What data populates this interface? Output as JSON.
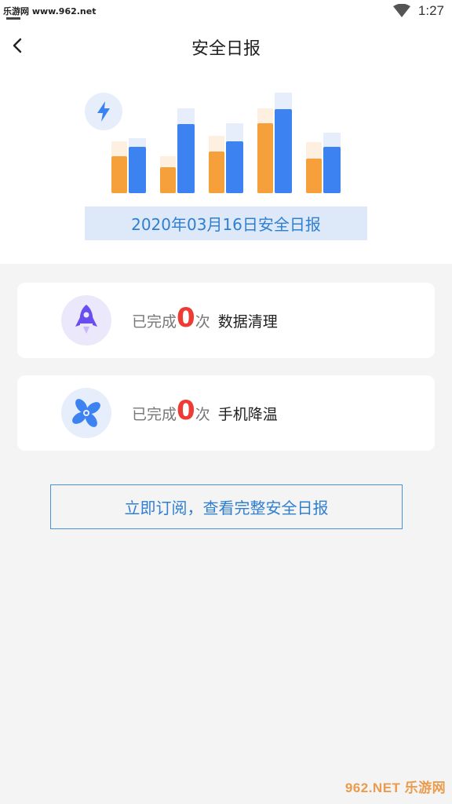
{
  "status_bar": {
    "site_text": "乐游网 www.962.net",
    "time": "1:27"
  },
  "header": {
    "title": "安全日报"
  },
  "hero": {
    "date_report": "2020年03月16日安全日报"
  },
  "cards": [
    {
      "prefix": "已完成",
      "count": "0",
      "suffix": "次",
      "task": "数据清理",
      "icon": "rocket-icon",
      "icon_bg": "#ece8fb"
    },
    {
      "prefix": "已完成",
      "count": "0",
      "suffix": "次",
      "task": "手机降温",
      "icon": "fan-icon",
      "icon_bg": "#e6eefb"
    }
  ],
  "subscribe_button": {
    "label": "立即订阅，查看完整安全日报"
  },
  "watermark": {
    "text": "962.NET 乐游网"
  },
  "colors": {
    "accent_blue": "#2f7fd1",
    "orange_bar": "#f5a03a",
    "blue_bar": "#3c82f0",
    "count_red": "#ee3b34"
  }
}
